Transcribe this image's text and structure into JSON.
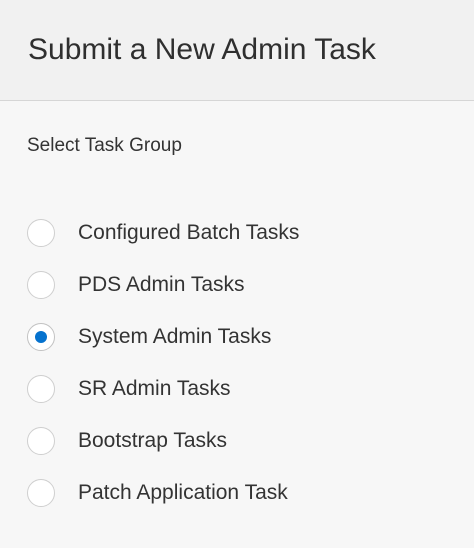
{
  "header": {
    "title": "Submit a New Admin Task"
  },
  "task_group": {
    "label": "Select Task Group",
    "selected": "System Admin Tasks",
    "accent_color": "#0572ce",
    "options": [
      {
        "label": "Configured Batch Tasks",
        "checked": false
      },
      {
        "label": "PDS Admin Tasks",
        "checked": false
      },
      {
        "label": "System Admin Tasks",
        "checked": true
      },
      {
        "label": "SR Admin Tasks",
        "checked": false
      },
      {
        "label": "Bootstrap Tasks",
        "checked": false
      },
      {
        "label": "Patch Application Task",
        "checked": false
      }
    ]
  }
}
